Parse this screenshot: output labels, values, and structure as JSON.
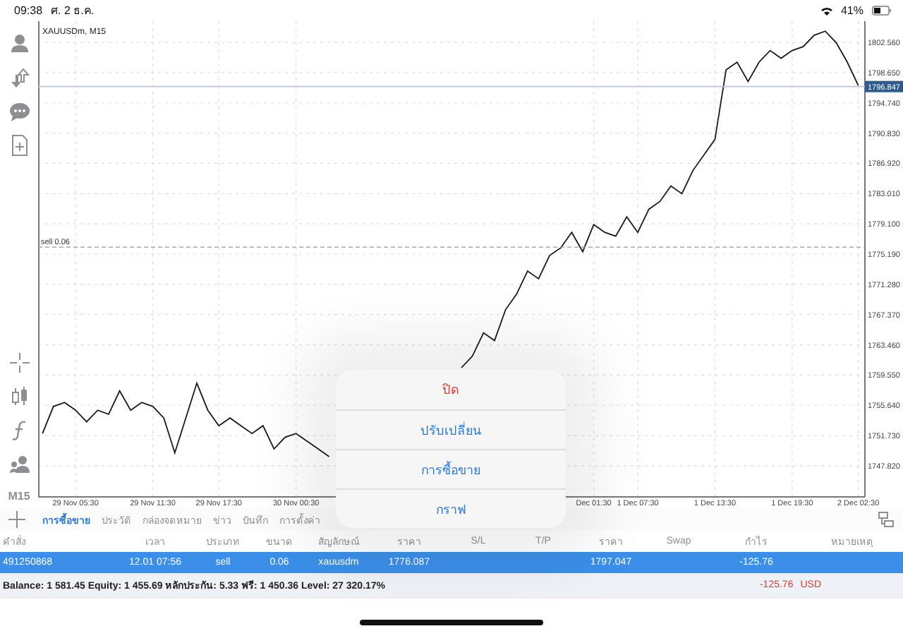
{
  "status_bar": {
    "time": "09:38",
    "date": "ศ. 2 ธ.ค.",
    "battery": "41%"
  },
  "toolbar": {
    "timeframe": "M15"
  },
  "chart": {
    "chart_data": {
      "type": "line",
      "title": "XAUUSDm, M15",
      "grid": true,
      "ylim": [
        1743.8,
        1805.3
      ],
      "categories": [
        null,
        null,
        null,
        "29 Nov 05:30",
        null,
        null,
        null,
        null,
        null,
        null,
        "29 Nov 11:30",
        null,
        null,
        null,
        null,
        null,
        "29 Nov 17:30",
        null,
        null,
        null,
        null,
        null,
        null,
        "30 Nov 00:30",
        null,
        null,
        null,
        null,
        null,
        null,
        null,
        null,
        null,
        null,
        null,
        null,
        null,
        null,
        null,
        null,
        null,
        null,
        null,
        null,
        null,
        null,
        null,
        null,
        null,
        null,
        "Dec 01:30",
        null,
        null,
        null,
        "1 Dec 07:30",
        null,
        null,
        null,
        null,
        null,
        null,
        "1 Dec 13:30",
        null,
        null,
        null,
        null,
        null,
        null,
        "1 Dec 19:30",
        null,
        null,
        null,
        null,
        null,
        "2 Dec 02:30"
      ],
      "yticks": [
        {
          "value": 1747.82,
          "label": "1747.820"
        },
        {
          "value": 1751.73,
          "label": "1751.730"
        },
        {
          "value": 1755.64,
          "label": "1755.640"
        },
        {
          "value": 1759.55,
          "label": "1759.550"
        },
        {
          "value": 1763.46,
          "label": "1763.460"
        },
        {
          "value": 1767.37,
          "label": "1767.370"
        },
        {
          "value": 1771.28,
          "label": "1771.280"
        },
        {
          "value": 1775.19,
          "label": "1775.190"
        },
        {
          "value": 1779.1,
          "label": "1779.100"
        },
        {
          "value": 1783.01,
          "label": "1783.010"
        },
        {
          "value": 1786.92,
          "label": "1786.920"
        },
        {
          "value": 1790.83,
          "label": "1790.830"
        },
        {
          "value": 1794.74,
          "label": "1794.740"
        },
        {
          "value": 1798.65,
          "label": "1798.650"
        },
        {
          "value": 1802.56,
          "label": "1802.560"
        }
      ],
      "series": [
        {
          "color": "#1a1a1a",
          "values": [
            1752,
            1755.5,
            1756,
            1755,
            1753.5,
            1755,
            1754.5,
            1757.5,
            1755,
            1756,
            1755.5,
            1754,
            1749.5,
            1754,
            1758.5,
            1755,
            1753,
            1754,
            1753,
            1752,
            1753,
            1750,
            1751.5,
            1752,
            1751,
            1750,
            1749,
            null,
            null,
            null,
            null,
            null,
            null,
            null,
            null,
            null,
            null,
            null,
            1760.5,
            1762,
            1765,
            1764,
            1768,
            1770,
            1773,
            1772,
            1775,
            1776,
            1778,
            1775.5,
            1779,
            1778,
            1777.5,
            1780,
            1778,
            1781,
            1782,
            1784,
            1783,
            1786,
            1788,
            1790,
            1799,
            1800,
            1797.5,
            1800,
            1801.5,
            1800.5,
            1801.5,
            1802,
            1803.5,
            1804,
            1802.5,
            1800,
            1797
          ]
        }
      ]
    },
    "order_line": {
      "label": "sell 0.06"
    },
    "price_line": {
      "label": "1796.847"
    }
  },
  "action_sheet": [
    {
      "label": "ปิด",
      "kind": "destructive"
    },
    {
      "label": "ปรับเปลี่ยน",
      "kind": "default"
    },
    {
      "label": "การซื้อขาย",
      "kind": "default"
    },
    {
      "label": "กราฟ",
      "kind": "default"
    }
  ],
  "tabs": [
    {
      "label": "การซื้อขาย",
      "selected": true
    },
    {
      "label": "ประวัติ",
      "selected": false
    },
    {
      "label": "กล่องจดหมาย",
      "selected": false
    },
    {
      "label": "ข่าว",
      "selected": false
    },
    {
      "label": "บันทึก",
      "selected": false
    },
    {
      "label": "การตั้งค่า",
      "selected": false
    }
  ],
  "table": {
    "columns": [
      "คำสั่ง",
      "เวลา",
      "ประเภท",
      "ขนาด",
      "สัญลักษณ์",
      "ราคา",
      "S/L",
      "T/P",
      "ราคา",
      "Swap",
      "กำไร",
      "หมายเหตุ"
    ],
    "rows": [
      {
        "order": "491250868",
        "time": "12.01 07:56",
        "type": "sell",
        "size": "0.06",
        "symbol": "xauusdm",
        "open_price": "1776.087",
        "current_price": "1797.047",
        "profit": "-125.76",
        "selected": true
      }
    ]
  },
  "summary": {
    "text": "Balance: 1 581.45 Equity: 1 455.69 หลักประกัน: 5.33 ฟรี: 1 450.36 Level: 27 320.17%",
    "profit": "-125.76",
    "currency": "USD"
  }
}
